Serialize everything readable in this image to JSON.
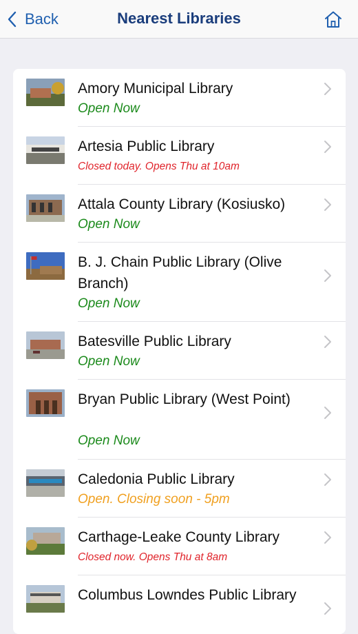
{
  "nav": {
    "back_label": "Back",
    "title": "Nearest Libraries",
    "home_icon": "home-icon"
  },
  "colors": {
    "accent": "#1f5faf",
    "title": "#1a3d7c",
    "open": "#1b8a1b",
    "closed": "#e0242b",
    "closing_soon": "#f0a020",
    "background": "#efeff4"
  },
  "libraries": [
    {
      "name": "Amory Municipal Library",
      "status": "Open Now",
      "status_type": "open"
    },
    {
      "name": "Artesia Public Library",
      "status": "Closed today. Opens Thu at 10am",
      "status_type": "closed"
    },
    {
      "name": "Attala County Library (Kosiusko)",
      "status": "Open Now",
      "status_type": "open"
    },
    {
      "name": "B. J. Chain Public Library (Olive Branch)",
      "status": "Open Now",
      "status_type": "open"
    },
    {
      "name": "Batesville Public Library",
      "status": "Open Now",
      "status_type": "open"
    },
    {
      "name": "Bryan Public Library (West Point)",
      "status": "Open Now",
      "status_type": "open"
    },
    {
      "name": "Caledonia Public Library",
      "status": "Open. Closing soon - 5pm",
      "status_type": "soon"
    },
    {
      "name": "Carthage-Leake County Library",
      "status": "Closed now. Opens Thu at 8am",
      "status_type": "closed"
    },
    {
      "name": "Columbus Lowndes Public Library",
      "status": "",
      "status_type": "open"
    }
  ]
}
